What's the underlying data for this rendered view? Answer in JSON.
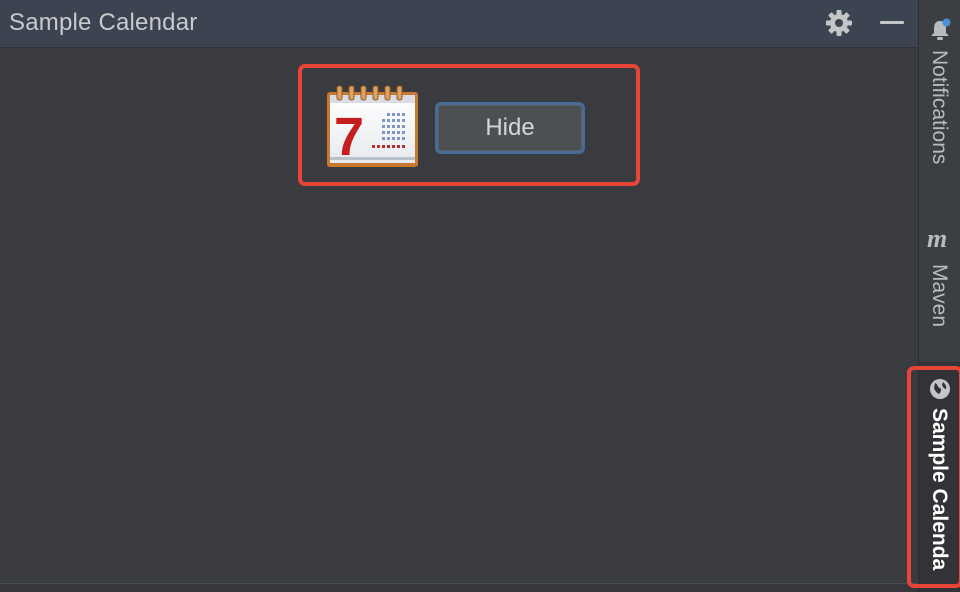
{
  "toolwindow": {
    "title": "Sample Calendar",
    "settings_icon": "gear-icon",
    "minimize_icon": "minimize-icon"
  },
  "content": {
    "calendar_icon": "calendar-icon",
    "calendar_day": "7",
    "hide_button_label": "Hide"
  },
  "sidebar": {
    "items": [
      {
        "label": "Notifications",
        "icon": "bell-icon"
      },
      {
        "label": "Maven",
        "icon": "maven-icon",
        "icon_glyph": "m"
      },
      {
        "label": "Sample Calenda",
        "icon": "globe-icon",
        "active": true
      }
    ]
  },
  "colors": {
    "highlight": "#e7443a",
    "header": "#3d4451",
    "background": "#393b3e",
    "button_border": "#4a6b99"
  }
}
